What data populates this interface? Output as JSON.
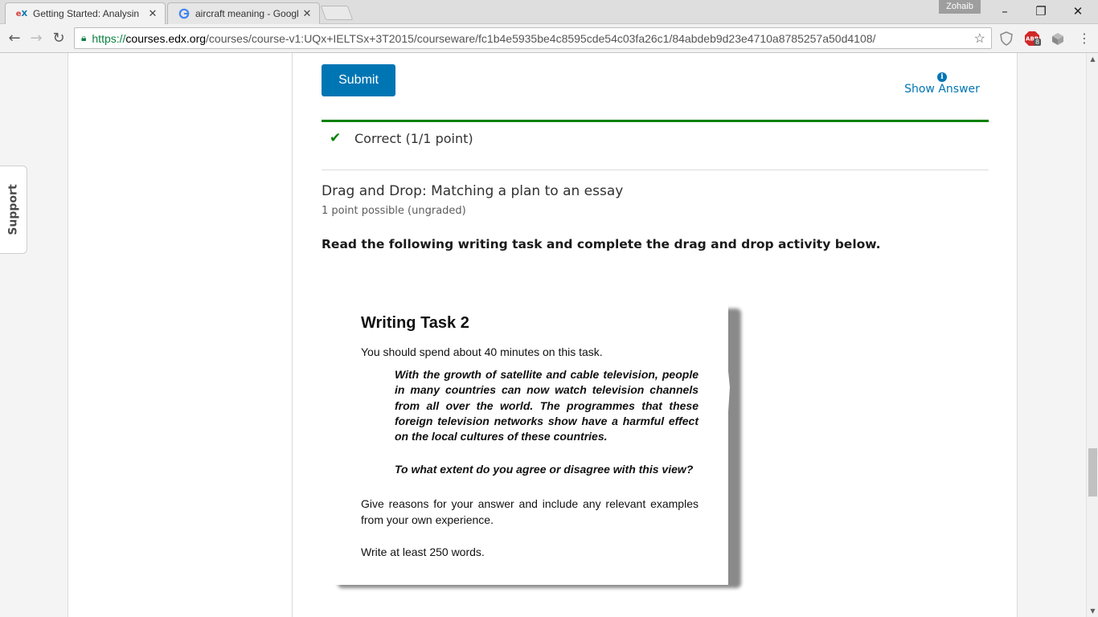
{
  "browser": {
    "tabs": [
      {
        "title": "Getting Started: Analysin",
        "favicon": "edx-favicon",
        "active": true
      },
      {
        "title": "aircraft meaning - Googl",
        "favicon": "google-favicon",
        "active": false
      }
    ],
    "profile_name": "Zohaib",
    "url": {
      "scheme": "https://",
      "host": "courses.edx.org",
      "path": "/courses/course-v1:UQx+IELTSx+3T2015/courseware/fc1b4e5935be4c8595cde54c03fa26c1/84abdeb9d23e4710a8785257a50d4108/"
    },
    "extension_badge": "8"
  },
  "support_label": "Support",
  "problem": {
    "submit_label": "Submit",
    "show_answer_label": "Show Answer",
    "status_text": "Correct (1/1 point)",
    "next_title": "Drag and Drop: Matching a plan to an essay",
    "next_meta": "1 point possible (ungraded)",
    "instruction": "Read the following writing task and complete the drag and drop activity below."
  },
  "task_card": {
    "heading": "Writing Task 2",
    "time_note": "You should spend about 40 minutes on this task.",
    "quote": "With the growth of satellite and cable television, people in many countries can now watch television channels from all over the world. The programmes that these foreign television networks show have a harmful effect on the local cultures of these countries.",
    "question": "To what extent do you agree or disagree with this view?",
    "reasons": "Give reasons for your answer and include any relevant examples from your own experience.",
    "word_count": "Write at least 250 words."
  },
  "colors": {
    "accent": "#0075b4",
    "success": "#008100"
  }
}
